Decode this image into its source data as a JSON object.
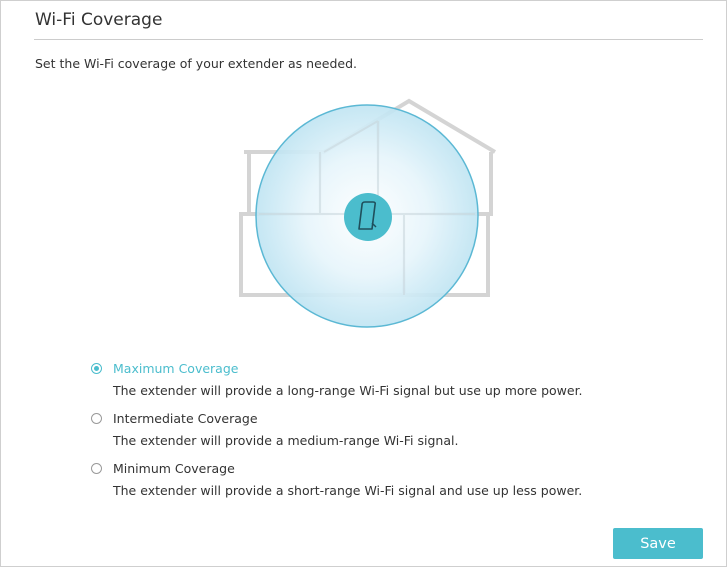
{
  "page": {
    "title": "Wi-Fi Coverage",
    "description": "Set the Wi-Fi coverage of your extender as needed."
  },
  "colors": {
    "accent": "#4bbdcd",
    "text": "#333333",
    "divider": "#cccccc",
    "house_outline": "#d4d4d4",
    "coverage_stroke": "#5bb8d4"
  },
  "illustration": {
    "house_icon": "house-outline-icon",
    "coverage_icon": "coverage-circle-icon",
    "device_icon": "extender-device-icon"
  },
  "coverage_options": [
    {
      "label": "Maximum Coverage",
      "description": "The extender will provide a long-range Wi-Fi signal but use up more power.",
      "selected": true
    },
    {
      "label": "Intermediate Coverage",
      "description": "The extender will provide a medium-range Wi-Fi signal.",
      "selected": false
    },
    {
      "label": "Minimum Coverage",
      "description": "The extender will provide a short-range Wi-Fi signal and use up less power.",
      "selected": false
    }
  ],
  "actions": {
    "save_label": "Save"
  }
}
